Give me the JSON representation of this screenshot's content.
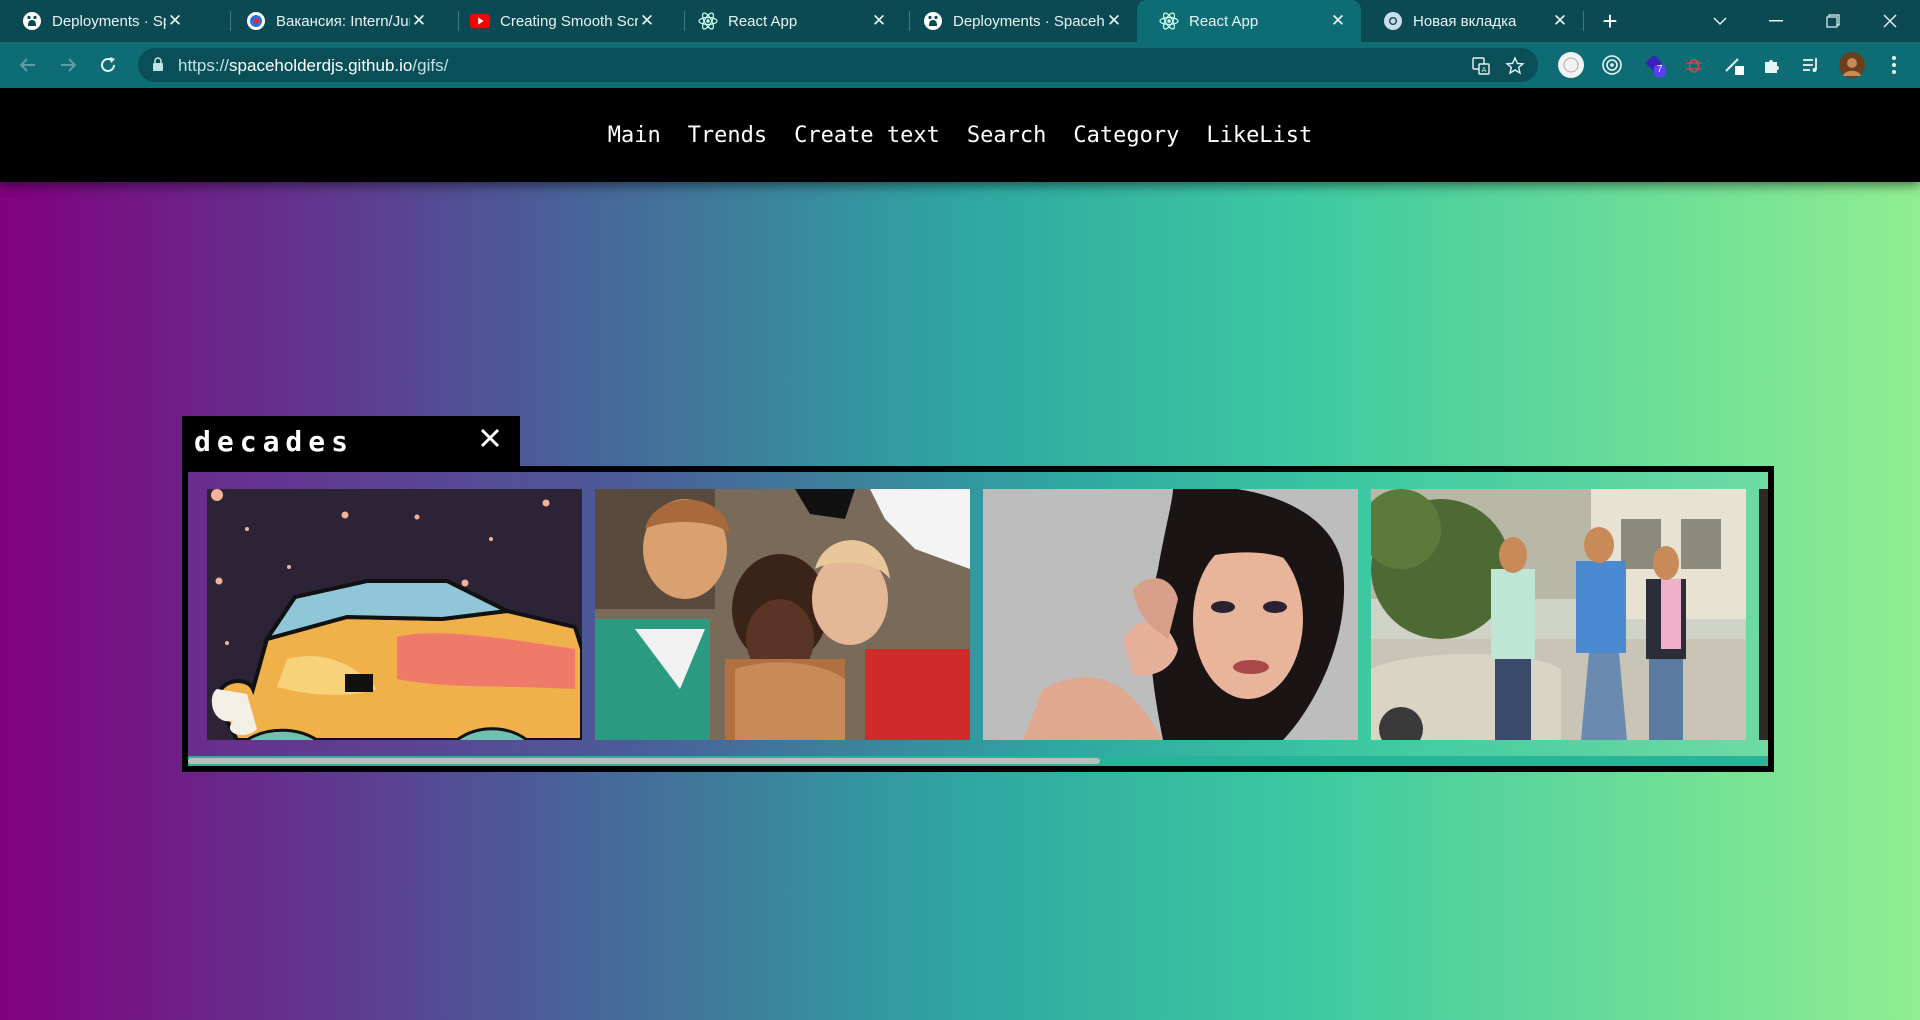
{
  "browser": {
    "tabs": [
      {
        "title": "Deployments · SpaceholderDJS",
        "icon": "github-icon",
        "active": false
      },
      {
        "title": "Вакансия: Intern/Junior",
        "icon": "hh-icon",
        "active": false
      },
      {
        "title": "Creating Smooth Scrolling",
        "icon": "youtube-icon",
        "active": false
      },
      {
        "title": "React App",
        "icon": "react-icon",
        "active": false
      },
      {
        "title": "Deployments · SpaceholderDJS",
        "icon": "github-icon",
        "active": false
      },
      {
        "title": "React App",
        "icon": "react-icon",
        "active": true
      },
      {
        "title": "Новая вкладка",
        "icon": "chrome-icon",
        "active": false
      }
    ],
    "url_scheme": "https://",
    "url_host": "spaceholderdjs.github.io",
    "url_path": "/gifs/",
    "extension_badge": "7",
    "colors": {
      "frame": "#0b4a52",
      "toolbar": "#0e6c75",
      "omnibox": "#0a4f57"
    }
  },
  "nav": {
    "items": [
      "Main",
      "Trends",
      "Create text",
      "Search",
      "Category",
      "LikeList"
    ]
  },
  "category": {
    "title": "decades",
    "gifs": [
      "cartoon-car-gif",
      "crowd-celebration-gif",
      "woman-portrait-gif",
      "street-fight-gif"
    ],
    "scroll_position_fraction": 0.58
  },
  "colors": {
    "gradient_start": "#800080",
    "gradient_mid": "#2ea6a1",
    "gradient_end": "#90ee90",
    "nav_background": "#000000"
  }
}
